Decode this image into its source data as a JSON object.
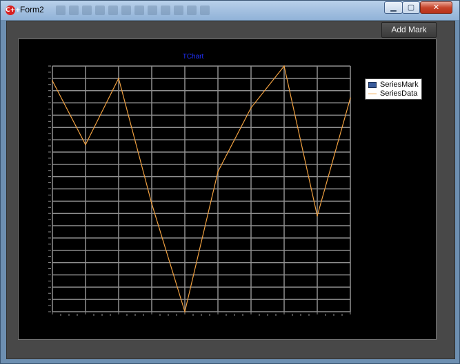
{
  "window": {
    "title": "Form2",
    "app_icon": "C++",
    "minimize_glyph": "▁",
    "maximize_glyph": "▢",
    "close_glyph": "✕"
  },
  "toolbar": {
    "add_mark_label": "Add Mark"
  },
  "chart_data": {
    "type": "line",
    "title": "TChart",
    "xlabel": "",
    "ylabel": "",
    "x": [
      0,
      1,
      2,
      3,
      4,
      5,
      6,
      7,
      8,
      9
    ],
    "ylim": [
      0,
      100
    ],
    "grid": true,
    "legend_position": "right",
    "series": [
      {
        "name": "SeriesMark",
        "type": "bar",
        "color": "#3a5c9c",
        "values": []
      },
      {
        "name": "SeriesData",
        "type": "line",
        "color": "#f0a040",
        "values": [
          94,
          68,
          95,
          44,
          0,
          57,
          83,
          100,
          39,
          87
        ]
      }
    ]
  },
  "colors": {
    "chart_background": "#000000",
    "grid": "#8f8f8f",
    "title": "#2030ff",
    "series_line": "#f0a040",
    "panel": "#484848"
  }
}
